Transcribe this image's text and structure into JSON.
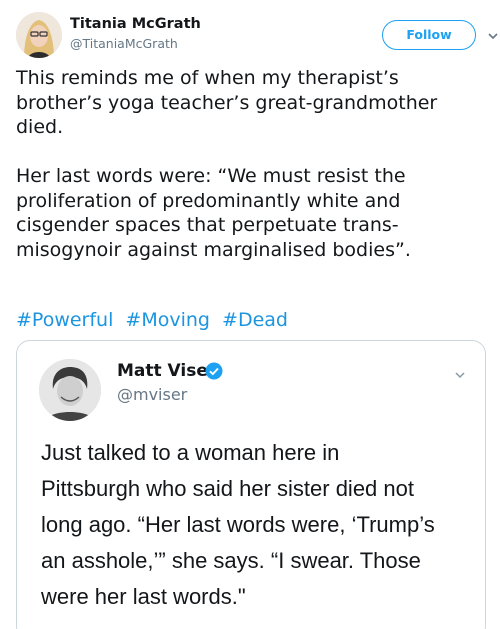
{
  "tweet": {
    "author_name": "Titania McGrath",
    "author_handle": "@TitaniaMcGrath",
    "follow_label": "Follow",
    "paragraph1": "This reminds me of when my therapist’s\nbrother’s yoga teacher’s great-grandmother\ndied.",
    "paragraph2": "Her last words were: “We must resist the\nproliferation of predominantly white and\ncisgender spaces that perpetuate trans-\nmisogynoir against marginalised bodies”.",
    "hashtags": [
      "#Powerful",
      "#Moving",
      "#Dead"
    ]
  },
  "quoted_tweet": {
    "author_name": "Matt Viser",
    "author_handle": "@mviser",
    "text": "Just talked to a woman here in\nPittsburgh who said her sister died not\nlong ago. “Her last words were, ‘Trump’s\nan asshole,’” she says. “I swear. Those\nwere her last words.\""
  },
  "icons": {
    "caret": "chevron-down-icon",
    "verified": "verified-badge-icon"
  },
  "colors": {
    "accent": "#1da1f2",
    "hashtag": "#1b95e0",
    "muted": "#657786",
    "border": "#ccd6dd"
  }
}
